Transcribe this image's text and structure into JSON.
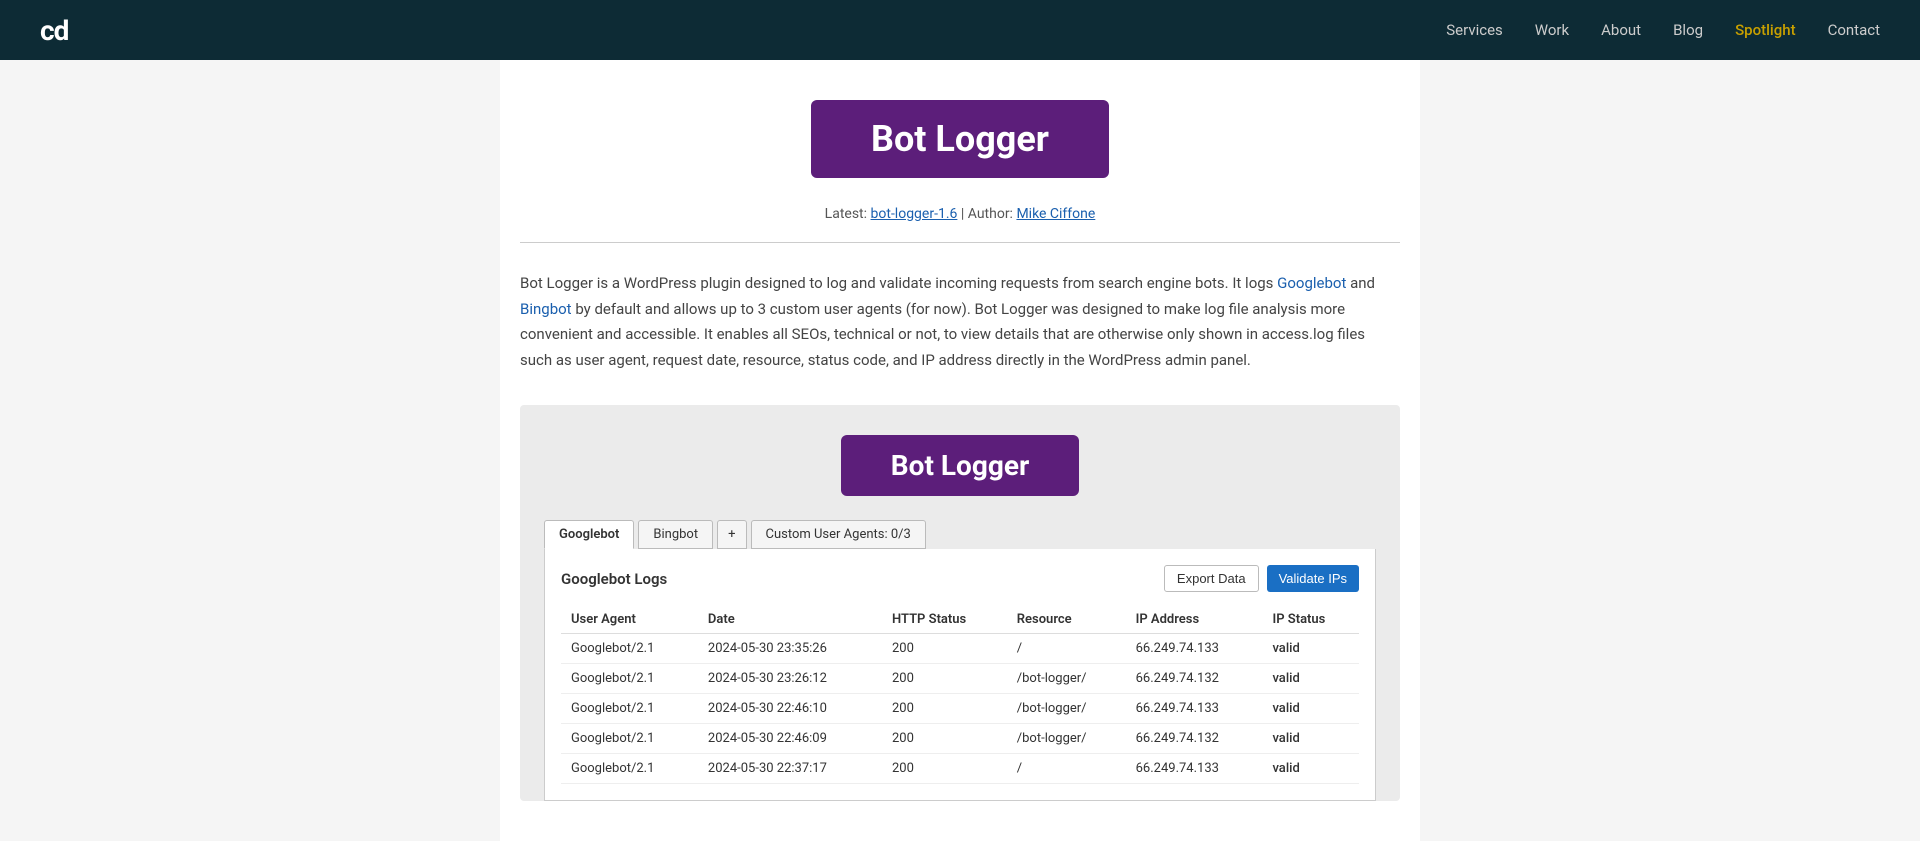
{
  "header": {
    "logo": "cd",
    "nav": [
      {
        "label": "Services",
        "href": "#",
        "active": false
      },
      {
        "label": "Work",
        "href": "#",
        "active": false
      },
      {
        "label": "About",
        "href": "#",
        "active": false
      },
      {
        "label": "Blog",
        "href": "#",
        "active": false
      },
      {
        "label": "Spotlight",
        "href": "#",
        "active": true
      },
      {
        "label": "Contact",
        "href": "#",
        "active": false
      }
    ]
  },
  "hero": {
    "title": "Bot Logger",
    "meta_latest_label": "Latest:",
    "meta_latest_link_text": "bot-logger-1.6",
    "meta_separator": "|",
    "meta_author_label": "Author:",
    "meta_author_link_text": "Mike Ciffone"
  },
  "description": {
    "text_parts": [
      "Bot Logger is a WordPress plugin designed to log and validate incoming requests from search engine bots. It logs ",
      "Googlebot",
      " and ",
      "Bingbot",
      " by default and allows up to 3 custom user agents (for now). Bot Logger was designed to make log file analysis more convenient and accessible. It enables all SEOs, technical or not, to view details that are otherwise only shown in access.log files such as user agent, request date, resource, status code, and IP address directly in the WordPress admin panel."
    ]
  },
  "screenshot": {
    "inner_title": "Bot Logger",
    "tabs": [
      {
        "label": "Googlebot",
        "active": true
      },
      {
        "label": "Bingbot",
        "active": false
      },
      {
        "label": "+",
        "is_plus": true
      },
      {
        "label": "Custom User Agents: 0/3",
        "active": false
      }
    ],
    "panel_title": "Googlebot Logs",
    "btn_export": "Export Data",
    "btn_validate": "Validate IPs",
    "table": {
      "headers": [
        "User Agent",
        "Date",
        "HTTP Status",
        "Resource",
        "IP Address",
        "IP Status"
      ],
      "rows": [
        {
          "user_agent": "Googlebot/2.1",
          "date": "2024-05-30 23:35:26",
          "http_status": "200",
          "resource": "/",
          "ip_address": "66.249.74.133",
          "ip_status": "valid"
        },
        {
          "user_agent": "Googlebot/2.1",
          "date": "2024-05-30 23:26:12",
          "http_status": "200",
          "resource": "/bot-logger/",
          "ip_address": "66.249.74.132",
          "ip_status": "valid"
        },
        {
          "user_agent": "Googlebot/2.1",
          "date": "2024-05-30 22:46:10",
          "http_status": "200",
          "resource": "/bot-logger/",
          "ip_address": "66.249.74.133",
          "ip_status": "valid"
        },
        {
          "user_agent": "Googlebot/2.1",
          "date": "2024-05-30 22:46:09",
          "http_status": "200",
          "resource": "/bot-logger/",
          "ip_address": "66.249.74.132",
          "ip_status": "valid"
        },
        {
          "user_agent": "Googlebot/2.1",
          "date": "2024-05-30 22:37:17",
          "http_status": "200",
          "resource": "/",
          "ip_address": "66.249.74.133",
          "ip_status": "valid"
        }
      ]
    }
  }
}
